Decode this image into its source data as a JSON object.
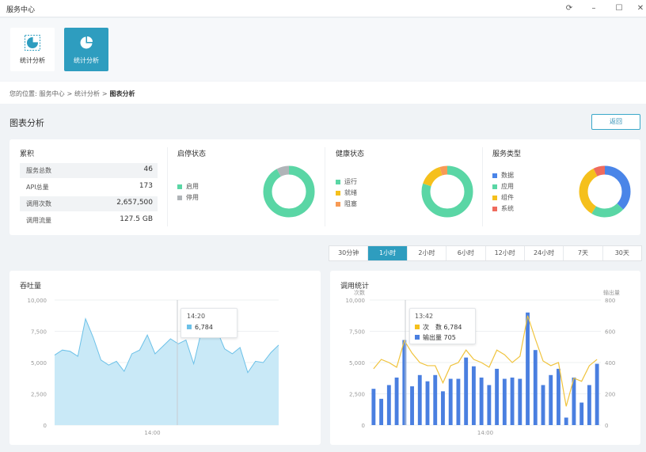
{
  "window": {
    "title": "服务中心",
    "controls": [
      "refresh-icon",
      "minimize-icon",
      "maximize-icon",
      "close-icon"
    ]
  },
  "tools": [
    {
      "label": "统计分析",
      "active": false
    },
    {
      "label": "统计分析",
      "active": true
    }
  ],
  "breadcrumb": {
    "prefix": "您的位置:",
    "items": [
      "服务中心",
      "统计分析",
      "图表分析"
    ],
    "separator": ">"
  },
  "page": {
    "title": "图表分析",
    "back_label": "返回"
  },
  "summary": {
    "accumulate": {
      "title": "累积",
      "rows": [
        {
          "label": "服务总数",
          "value": "46"
        },
        {
          "label": "API总量",
          "value": "173"
        },
        {
          "label": "调用次数",
          "value": "2,657,500"
        },
        {
          "label": "调用流量",
          "value": "127.5 GB"
        }
      ]
    },
    "start_stop": {
      "title": "启停状态",
      "legend": [
        {
          "name": "启用",
          "color": "#5ad6a5"
        },
        {
          "name": "停用",
          "color": "#b0b4b8"
        }
      ]
    },
    "health": {
      "title": "健康状态",
      "legend": [
        {
          "name": "运行",
          "color": "#5ad6a5"
        },
        {
          "name": "就绪",
          "color": "#f5c01c"
        },
        {
          "name": "阻塞",
          "color": "#f79a55"
        }
      ]
    },
    "service_type": {
      "title": "服务类型",
      "legend": [
        {
          "name": "数据",
          "color": "#4a85e8"
        },
        {
          "name": "应用",
          "color": "#5ad6a5"
        },
        {
          "name": "组件",
          "color": "#f5c01c"
        },
        {
          "name": "系统",
          "color": "#ef6b5d"
        }
      ]
    }
  },
  "time_ranges": {
    "options": [
      "30分钟",
      "1小时",
      "2小时",
      "6小时",
      "12小时",
      "24小时",
      "7天",
      "30天"
    ],
    "selected": "1小时"
  },
  "throughput": {
    "title": "吞吐量",
    "tooltip": {
      "time": "14:20",
      "value": "6,784"
    }
  },
  "calls": {
    "title": "调用统计",
    "tooltip": {
      "time": "13:42",
      "count_label": "次　数",
      "count_value": "6,784",
      "output_label": "输出量",
      "output_value": "705"
    }
  },
  "chart_data": [
    {
      "type": "pie",
      "title": "启停状态",
      "labels": [
        "启用",
        "停用"
      ],
      "values": [
        92,
        8
      ]
    },
    {
      "type": "pie",
      "title": "健康状态",
      "labels": [
        "运行",
        "就绪",
        "阻塞"
      ],
      "values": [
        80,
        15,
        5
      ]
    },
    {
      "type": "pie",
      "title": "服务类型",
      "labels": [
        "数据",
        "应用",
        "组件",
        "系统"
      ],
      "values": [
        35,
        20,
        32,
        7
      ]
    },
    {
      "type": "area",
      "title": "吞吐量",
      "xticks": [
        "14:00"
      ],
      "yticks": [
        "0",
        "2,500",
        "5,000",
        "7,500",
        "10,000"
      ],
      "ylim": [
        0,
        10000
      ],
      "values": [
        5600,
        6000,
        5900,
        5500,
        8500,
        7000,
        5200,
        4800,
        5100,
        4300,
        5700,
        6000,
        7200,
        5700,
        6300,
        6900,
        6500,
        6800,
        4900,
        7500,
        8000,
        7600,
        6100,
        5700,
        6200,
        4200,
        5100,
        5000,
        5800,
        6400
      ]
    },
    {
      "type": "bar",
      "title": "调用统计",
      "ylabel": "次数",
      "y2label": "输出量",
      "xticks": [
        "14:00"
      ],
      "yticks": [
        "0",
        "2,500",
        "5,000",
        "7,500",
        "10,000"
      ],
      "y2ticks": [
        "0",
        "200",
        "400",
        "600",
        "800"
      ],
      "ylim": [
        0,
        10000
      ],
      "y2lim": [
        0,
        800
      ],
      "series": [
        {
          "name": "次　数",
          "type": "bar",
          "values": [
            2900,
            2100,
            3200,
            3800,
            6800,
            3100,
            4000,
            3500,
            4000,
            2700,
            3700,
            3700,
            5400,
            4700,
            3800,
            3200,
            4500,
            3700,
            3800,
            3700,
            9000,
            6000,
            3200,
            4000,
            4500,
            600,
            3800,
            1800,
            3200,
            4900
          ]
        },
        {
          "name": "输出量",
          "type": "line",
          "values": [
            360,
            420,
            400,
            370,
            540,
            460,
            400,
            380,
            380,
            270,
            380,
            400,
            480,
            420,
            400,
            370,
            480,
            450,
            400,
            440,
            700,
            550,
            410,
            380,
            400,
            120,
            300,
            280,
            380,
            420
          ]
        }
      ]
    }
  ]
}
